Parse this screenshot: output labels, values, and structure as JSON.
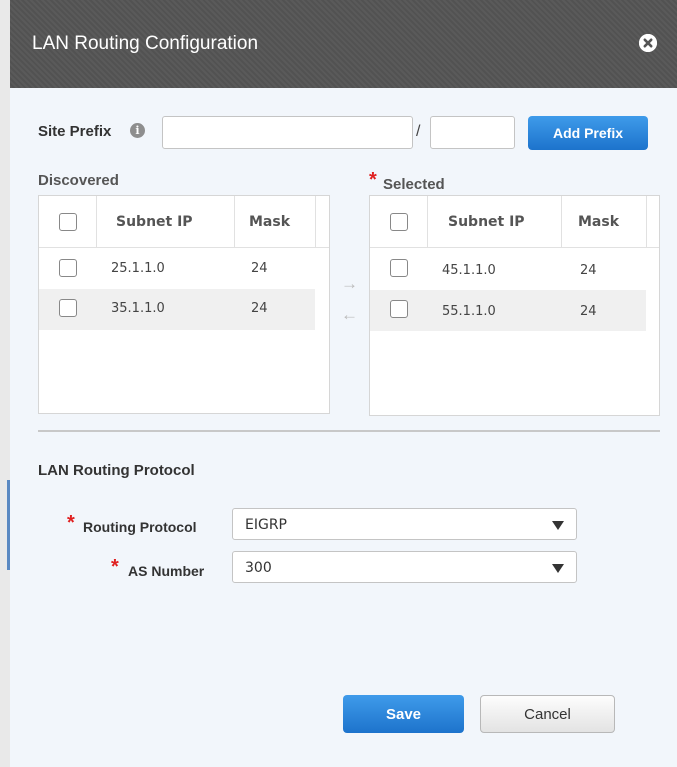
{
  "dialog": {
    "title": "LAN Routing Configuration",
    "close_icon": "close-circle-icon"
  },
  "site_prefix": {
    "label": "Site Prefix",
    "info_icon": "info-icon",
    "info_glyph": "i",
    "prefix_value": "",
    "separator": "/",
    "mask_value": "",
    "add_button": "Add Prefix"
  },
  "discovered": {
    "label": "Discovered",
    "columns": [
      "Subnet IP",
      "Mask"
    ],
    "rows": [
      {
        "subnet_ip": "25.1.1.0",
        "mask": "24"
      },
      {
        "subnet_ip": "35.1.1.0",
        "mask": "24"
      }
    ]
  },
  "transfer": {
    "move_right": "→",
    "move_left": "←"
  },
  "selected": {
    "required_mark": "*",
    "label": "Selected",
    "columns": [
      "Subnet IP",
      "Mask"
    ],
    "rows": [
      {
        "subnet_ip": "45.1.1.0",
        "mask": "24"
      },
      {
        "subnet_ip": "55.1.1.0",
        "mask": "24"
      }
    ]
  },
  "lan_routing": {
    "heading": "LAN Routing Protocol",
    "routing_protocol": {
      "required_mark": "*",
      "label": "Routing Protocol",
      "value": "EIGRP"
    },
    "as_number": {
      "required_mark": "*",
      "label": "AS Number",
      "value": "300"
    }
  },
  "footer": {
    "save": "Save",
    "cancel": "Cancel"
  },
  "colors": {
    "header_bg": "#555555",
    "modal_bg": "#f2f6fb",
    "primary": "#1d73cc",
    "required": "#e02020"
  }
}
